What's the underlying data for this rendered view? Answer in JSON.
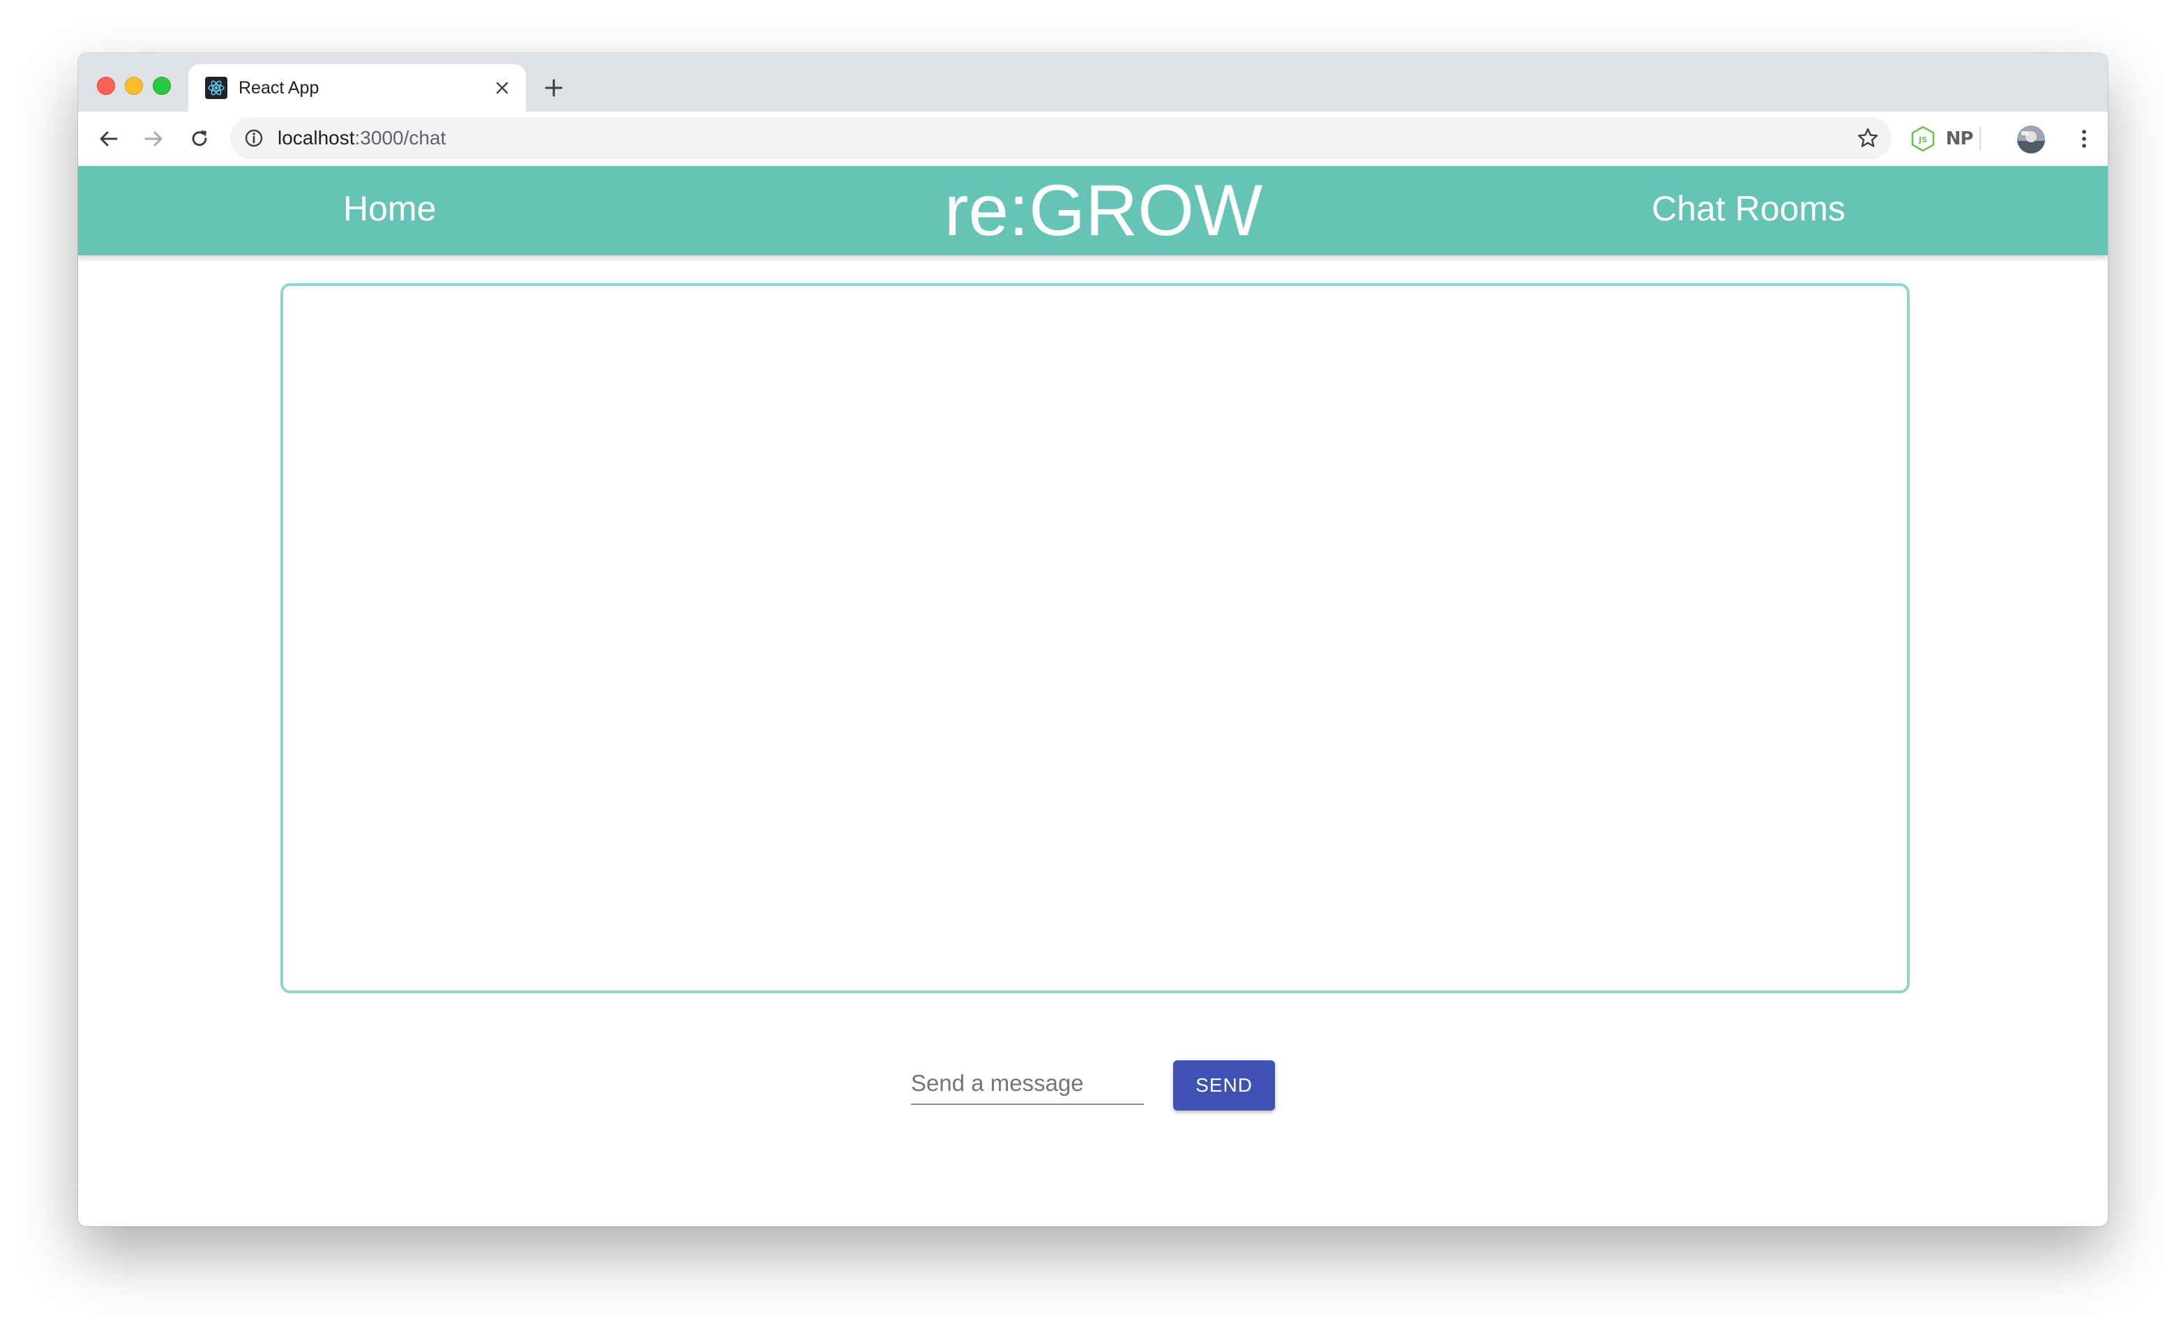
{
  "browser": {
    "tab": {
      "title": "React App",
      "favicon": "react-logo-icon"
    },
    "address_bar": {
      "host": "localhost",
      "path": ":3000/chat"
    },
    "extensions": {
      "np_label": "NP"
    },
    "icons": [
      "back-arrow-icon",
      "forward-arrow-icon",
      "reload-icon",
      "info-icon",
      "star-icon",
      "node-js-icon",
      "np-icon",
      "avatar",
      "more-vert-icon"
    ]
  },
  "app": {
    "nav": {
      "home": "Home",
      "brand": "re:GROW",
      "chat_rooms": "Chat Rooms"
    },
    "composer": {
      "placeholder": "Send a message",
      "send_label": "SEND"
    },
    "colors": {
      "header": "#66c4b7",
      "chat_border": "#8fd5cb",
      "send_button": "#3f51b5"
    }
  }
}
